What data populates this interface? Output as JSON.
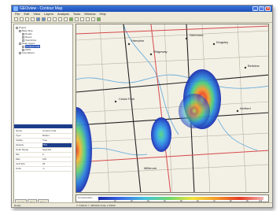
{
  "window": {
    "title": "GEOview - Contour Map",
    "menus": [
      "File",
      "Edit",
      "View",
      "Layers",
      "Analysis",
      "Tools",
      "Window",
      "Help"
    ]
  },
  "tree": {
    "items": [
      {
        "label": "Project",
        "level": 0
      },
      {
        "label": "Base Map",
        "level": 1
      },
      {
        "label": "Roads",
        "level": 2
      },
      {
        "label": "Rivers",
        "level": 2
      },
      {
        "label": "Townships",
        "level": 2
      },
      {
        "label": "Data Layers",
        "level": 1
      },
      {
        "label": "Contour Grid",
        "level": 2,
        "selected": true
      },
      {
        "label": "Wells",
        "level": 2
      },
      {
        "label": "Annotations",
        "level": 1
      }
    ]
  },
  "properties": {
    "header": "Properties",
    "rows": [
      {
        "k": "Name",
        "v": "Contour Grid"
      },
      {
        "k": "Type",
        "v": "Raster"
      },
      {
        "k": "Visible",
        "v": "True"
      },
      {
        "k": "Opacity",
        "v": "75%",
        "highlight": true
      },
      {
        "k": "Color Ramp",
        "v": "Spectral"
      },
      {
        "k": "Min",
        "v": "0"
      },
      {
        "k": "Max",
        "v": "100"
      },
      {
        "k": "Cell Size",
        "v": "25"
      },
      {
        "k": "Units",
        "v": "m"
      }
    ]
  },
  "tabs": [
    "Layers",
    "Data",
    "Props"
  ],
  "map": {
    "labels": [
      "Hampton",
      "Glenmore",
      "Ridgeway",
      "Cedar Park",
      "Bellview",
      "Ashford",
      "Kingsley",
      "Millbrook"
    ]
  },
  "legend": {
    "title": "Concentration",
    "ticks": [
      "0",
      "10",
      "20",
      "30",
      "40",
      "50",
      "60",
      "70",
      "80",
      "90",
      "100"
    ]
  },
  "status": {
    "left": "Ready",
    "right": "X: 548210  Y: 4852930  Scale 1:50000"
  }
}
